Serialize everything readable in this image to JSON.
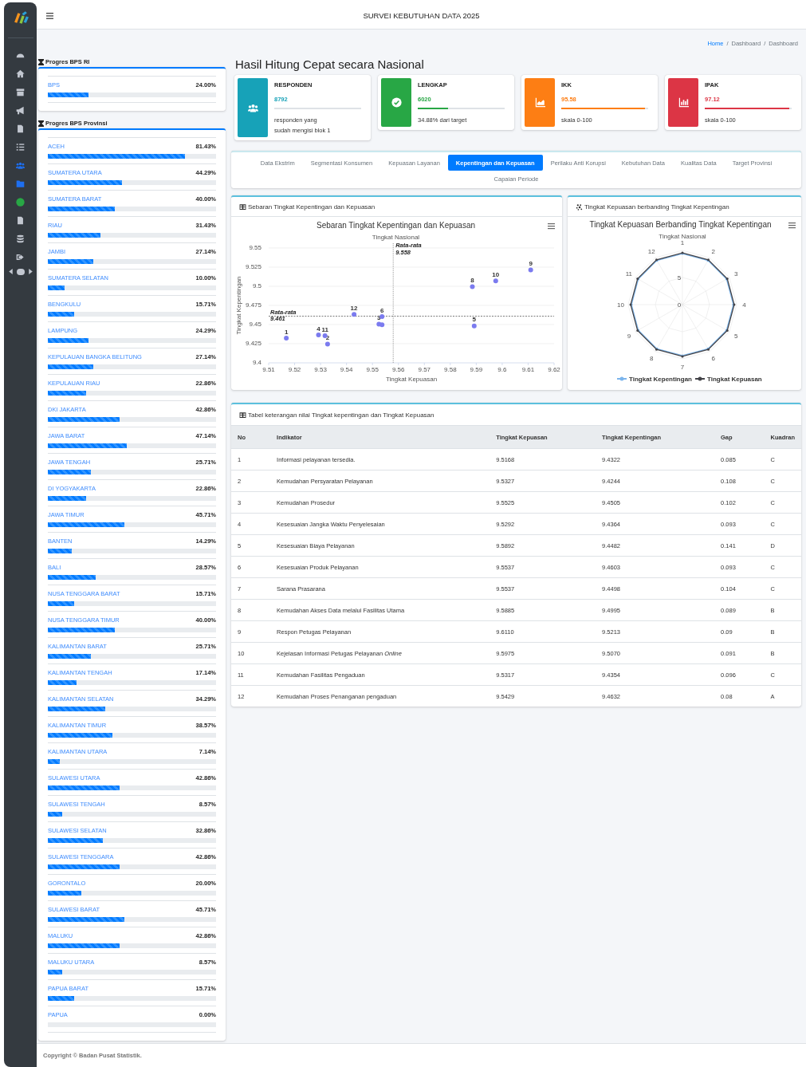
{
  "header": {
    "title": "SURVEI KEBUTUHAN DATA 2025"
  },
  "sidebar": {
    "items": [
      {
        "kind": "gauge",
        "selected": false
      },
      {
        "kind": "home",
        "selected": false
      },
      {
        "kind": "archive",
        "selected": false
      },
      {
        "kind": "bullhorn",
        "selected": false
      },
      {
        "kind": "file",
        "selected": false
      },
      {
        "kind": "list",
        "selected": false
      },
      {
        "kind": "users",
        "selected": true
      },
      {
        "kind": "folder",
        "selected": true
      },
      {
        "kind": "dot",
        "selected": false
      },
      {
        "kind": "pdf",
        "selected": false
      },
      {
        "kind": "database",
        "selected": false
      },
      {
        "kind": "signout",
        "selected": false
      }
    ]
  },
  "breadcrumb": {
    "items": [
      {
        "label": "Home",
        "kind": "link"
      },
      {
        "label": "Dashboard",
        "kind": "text"
      },
      {
        "label": "Dashboard",
        "kind": "text"
      }
    ],
    "separators": [
      "/",
      "/"
    ]
  },
  "progress_ri": {
    "title": "Progres BPS RI",
    "items": [
      {
        "name": "BPS",
        "value": "24.00%",
        "level": 0.24
      }
    ]
  },
  "progress_provinsi": {
    "title": "Progres BPS Provinsi",
    "items": [
      {
        "name": "ACEH",
        "value": "81.43%",
        "level": 0.8143
      },
      {
        "name": "SUMATERA UTARA",
        "value": "44.29%",
        "level": 0.4429
      },
      {
        "name": "SUMATERA BARAT",
        "value": "40.00%",
        "level": 0.4
      },
      {
        "name": "RIAU",
        "value": "31.43%",
        "level": 0.3143
      },
      {
        "name": "JAMBI",
        "value": "27.14%",
        "level": 0.2714
      },
      {
        "name": "SUMATERA SELATAN",
        "value": "10.00%",
        "level": 0.1
      },
      {
        "name": "BENGKULU",
        "value": "15.71%",
        "level": 0.1571
      },
      {
        "name": "LAMPUNG",
        "value": "24.29%",
        "level": 0.2429
      },
      {
        "name": "KEPULAUAN BANGKA BELITUNG",
        "value": "27.14%",
        "level": 0.2714
      },
      {
        "name": "KEPULAUAN RIAU",
        "value": "22.86%",
        "level": 0.2286
      },
      {
        "name": "DKI JAKARTA",
        "value": "42.86%",
        "level": 0.4286
      },
      {
        "name": "JAWA BARAT",
        "value": "47.14%",
        "level": 0.4714
      },
      {
        "name": "JAWA TENGAH",
        "value": "25.71%",
        "level": 0.2571
      },
      {
        "name": "DI YOGYAKARTA",
        "value": "22.86%",
        "level": 0.2286
      },
      {
        "name": "JAWA TIMUR",
        "value": "45.71%",
        "level": 0.4571
      },
      {
        "name": "BANTEN",
        "value": "14.29%",
        "level": 0.1429
      },
      {
        "name": "BALI",
        "value": "28.57%",
        "level": 0.2857
      },
      {
        "name": "NUSA TENGGARA BARAT",
        "value": "15.71%",
        "level": 0.1571
      },
      {
        "name": "NUSA TENGGARA TIMUR",
        "value": "40.00%",
        "level": 0.4
      },
      {
        "name": "KALIMANTAN BARAT",
        "value": "25.71%",
        "level": 0.2571
      },
      {
        "name": "KALIMANTAN TENGAH",
        "value": "17.14%",
        "level": 0.1714
      },
      {
        "name": "KALIMANTAN SELATAN",
        "value": "34.29%",
        "level": 0.3429
      },
      {
        "name": "KALIMANTAN TIMUR",
        "value": "38.57%",
        "level": 0.3857
      },
      {
        "name": "KALIMANTAN UTARA",
        "value": "7.14%",
        "level": 0.0714
      },
      {
        "name": "SULAWESI UTARA",
        "value": "42.86%",
        "level": 0.4286
      },
      {
        "name": "SULAWESI TENGAH",
        "value": "8.57%",
        "level": 0.0857
      },
      {
        "name": "SULAWESI SELATAN",
        "value": "32.86%",
        "level": 0.3286
      },
      {
        "name": "SULAWESI TENGGARA",
        "value": "42.86%",
        "level": 0.4286
      },
      {
        "name": "GORONTALO",
        "value": "20.00%",
        "level": 0.2
      },
      {
        "name": "SULAWESI BARAT",
        "value": "45.71%",
        "level": 0.4571
      },
      {
        "name": "MALUKU",
        "value": "42.86%",
        "level": 0.4286
      },
      {
        "name": "MALUKU UTARA",
        "value": "8.57%",
        "level": 0.0857
      },
      {
        "name": "PAPUA BARAT",
        "value": "15.71%",
        "level": 0.1571
      },
      {
        "name": "PAPUA",
        "value": "0.00%",
        "level": 0
      }
    ]
  },
  "main_title": "Hasil Hitung Cepat secara Nasional",
  "stats": [
    {
      "kind": "users",
      "color": "#17a2b8",
      "title": "RESPONDEN",
      "value": "8792",
      "level": 0,
      "description": "responden yang sudah mengisi blok 1"
    },
    {
      "kind": "check",
      "color": "#28a745",
      "title": "LENGKAP",
      "value": "6020",
      "level": 0.35,
      "description": "34.88% dari target"
    },
    {
      "kind": "area",
      "color": "#fd7e14",
      "title": "IKK",
      "value": "95.58",
      "level": 0.96,
      "description": "skala 0-100"
    },
    {
      "kind": "bar",
      "color": "#dc3545",
      "title": "IPAK",
      "value": "97.12",
      "level": 0.97,
      "description": "skala 0-100"
    }
  ],
  "tabs": [
    {
      "label": "Data Ekstrim",
      "selected": false
    },
    {
      "label": "Segmentasi Konsumen",
      "selected": false
    },
    {
      "label": "Kepuasan Layanan",
      "selected": false
    },
    {
      "label": "Kepentingan dan Kepuasan",
      "selected": true
    },
    {
      "label": "Perilaku Anti Korupsi",
      "selected": false
    },
    {
      "label": "Kebutuhan Data",
      "selected": false
    },
    {
      "label": "Kualitas Data",
      "selected": false
    },
    {
      "label": "Target Provinsi",
      "selected": false
    },
    {
      "label": "Capaian Periode",
      "selected": false
    }
  ],
  "scatter_card": {
    "title": "Sebaran Tingkat Kepentingan dan Kepuasan",
    "chart_data": {
      "type": "scatter",
      "title": "Sebaran Tingkat Kepentingan dan Kepuasan",
      "subtitle": "Tingkat Nasional",
      "xlabel": "Tingkat Kepuasan",
      "ylabel": "Tingkat Kepentingan",
      "xlim": [
        9.51,
        9.62
      ],
      "ylim": [
        9.4,
        9.55
      ],
      "grid": true,
      "x": [
        9.5168,
        9.5327,
        9.5525,
        9.5292,
        9.5892,
        9.5537,
        9.5537,
        9.5885,
        9.611,
        9.5975,
        9.5317,
        9.5429
      ],
      "xticks": [
        9.51,
        9.52,
        9.53,
        9.54,
        9.55,
        9.56,
        9.57,
        9.58,
        9.59,
        9.6,
        9.61,
        9.62
      ],
      "yticks": [
        9.4,
        9.425,
        9.45,
        9.475,
        9.5,
        9.525,
        9.55
      ],
      "series": [
        {
          "color": "#7b7bef",
          "values": [
            9.4322,
            9.4244,
            9.4505,
            9.4364,
            9.4482,
            9.4603,
            9.4498,
            9.4995,
            9.5213,
            9.507,
            9.4354,
            9.4632
          ]
        }
      ],
      "value_labels": [
        "1",
        "2",
        "3",
        "4",
        "5",
        "6",
        null,
        "8",
        "9",
        "10",
        "11",
        "12"
      ],
      "ref_lines": [
        {
          "axis": "x",
          "value": 9.558,
          "label": "Rata-rata 9.558"
        },
        {
          "axis": "y",
          "value": 9.461,
          "label": "Rata-rata 9.461"
        }
      ]
    }
  },
  "radar_card": {
    "title": "Tingkat Kepuasan berbanding Tingkat Kepentingan",
    "chart_title": "Tingkat Kepuasan Berbanding Tingkat Kepentingan",
    "subtitle": "Tingkat Nasional",
    "axis_labels": [
      "1",
      "2",
      "3",
      "4",
      "5",
      "6",
      "7",
      "8",
      "9",
      "10",
      "11",
      "12"
    ],
    "tick_labels": [
      "5",
      "0"
    ],
    "legend": [
      {
        "name": "Tingkat Kepentingan",
        "color": "#7cb5ec"
      },
      {
        "name": "Tingkat Kepuasan",
        "color": "#434348"
      }
    ]
  },
  "table_card": {
    "title": "Tabel keterangan nilai Tingkat kepentingan dan Tingkat Kepuasan",
    "columns": [
      "No",
      "Indikator",
      "Tingkat Kepuasan",
      "Tingkat Kepentingan",
      "Gap",
      "Kuadran"
    ],
    "rows": [
      [
        "1",
        "Informasi pelayanan tersedia.",
        "9.5168",
        "9.4322",
        "0.085",
        "C"
      ],
      [
        "2",
        "Kemudahan Persyaratan Pelayanan",
        "9.5327",
        "9.4244",
        "0.108",
        "C"
      ],
      [
        "3",
        "Kemudahan Prosedur",
        "9.5525",
        "9.4505",
        "0.102",
        "C"
      ],
      [
        "4",
        "Kesesuaian Jangka Waktu Penyelesaian",
        "9.5292",
        "9.4364",
        "0.093",
        "C"
      ],
      [
        "5",
        "Kesesuaian Biaya Pelayanan",
        "9.5892",
        "9.4482",
        "0.141",
        "D"
      ],
      [
        "6",
        "Kesesuaian Produk Pelayanan",
        "9.5537",
        "9.4603",
        "0.093",
        "C"
      ],
      [
        "7",
        "Sarana Prasarana",
        "9.5537",
        "9.4498",
        "0.104",
        "C"
      ],
      [
        "8",
        "Kemudahan Akses Data melalui Fasilitas Utama",
        "9.5885",
        "9.4995",
        "0.089",
        "B"
      ],
      [
        "9",
        "Respon Petugas Pelayanan",
        "9.6110",
        "9.5213",
        "0.09",
        "B"
      ],
      [
        "10",
        "Kejelasan Informasi Petugas Pelayanan *Online*",
        "9.5975",
        "9.5070",
        "0.091",
        "B"
      ],
      [
        "11",
        "Kemudahan Fasilitas Pengaduan",
        "9.5317",
        "9.4354",
        "0.096",
        "C"
      ],
      [
        "12",
        "Kemudahan Proses Penanganan pengaduan",
        "9.5429",
        "9.4632",
        "0.08",
        "A"
      ]
    ]
  },
  "footer": {
    "text": "Copyright © Badan Pusat Statistik."
  }
}
